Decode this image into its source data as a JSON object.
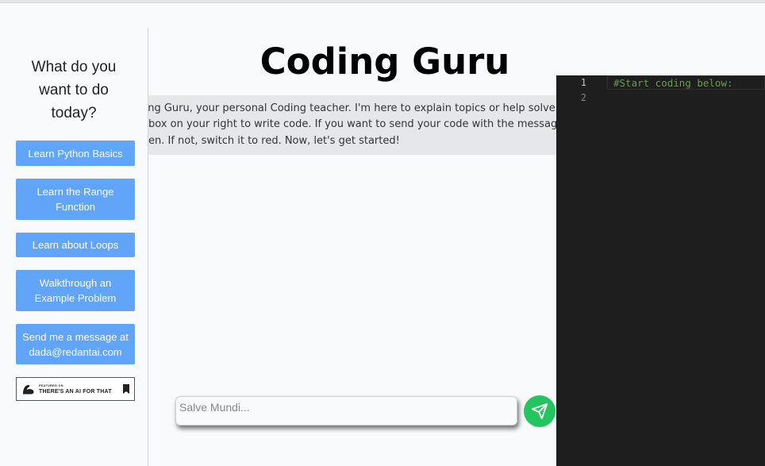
{
  "sidebar": {
    "heading": "What do you want to do today?",
    "buttons": [
      {
        "label": "Learn Python Basics"
      },
      {
        "label": "Learn the Range Function"
      },
      {
        "label": "Learn about Loops"
      },
      {
        "label": "Walkthrough an Example Problem"
      },
      {
        "label": "Send me a message at dada@redantai.com"
      }
    ],
    "badge": {
      "small_text": "FEATURED ON",
      "main_text": "THERE'S AN AI FOR THAT",
      "logo_icon": "flexed-arm-icon",
      "bookmark_icon": "bookmark-icon"
    }
  },
  "main": {
    "title": "Coding Guru",
    "intro_lines": [
      "ling Guru, your personal Coding teacher. I'm here to explain topics or help solve pro",
      "ebox on your right to write code. If you want to send your code with the message, t",
      "een. If not, switch it to red. Now, let's get started!"
    ]
  },
  "chat": {
    "placeholder": "Salve Mundi...",
    "value": "",
    "send_icon": "send-icon",
    "send_color": "#22c55e"
  },
  "editor": {
    "line_numbers": [
      "1",
      "2"
    ],
    "lines": [
      "#Start coding below:",
      ""
    ]
  },
  "colors": {
    "button_blue": "#60a5fa",
    "editor_bg": "#1e1e1e",
    "comment_green": "#6a9955"
  }
}
